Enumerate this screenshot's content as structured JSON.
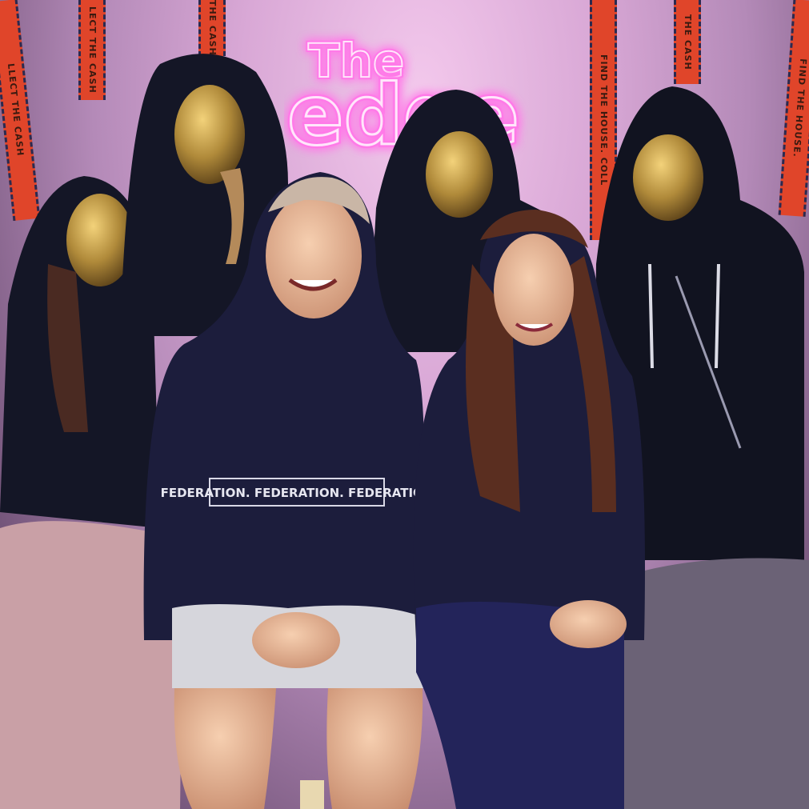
{
  "neon_sign": {
    "line1": "The",
    "line2": "edge"
  },
  "tapes": [
    {
      "text": "LLECT THE CASH"
    },
    {
      "text": "LECT THE CASH"
    },
    {
      "text": "THE CASH"
    },
    {
      "text": "FIND THE HOUSE. COLL"
    },
    {
      "text": "THE CASH"
    },
    {
      "text": "FIND THE HOUSE."
    }
  ],
  "hoodie_print": "FEDERATION. FEDERATION. FEDERATION",
  "colors": {
    "neon": "#ff7ae8",
    "neon_core": "#ffe6fb",
    "tape": "#e0452a",
    "hoodie": "#1c1d3c",
    "mask": "#b08a3a"
  }
}
